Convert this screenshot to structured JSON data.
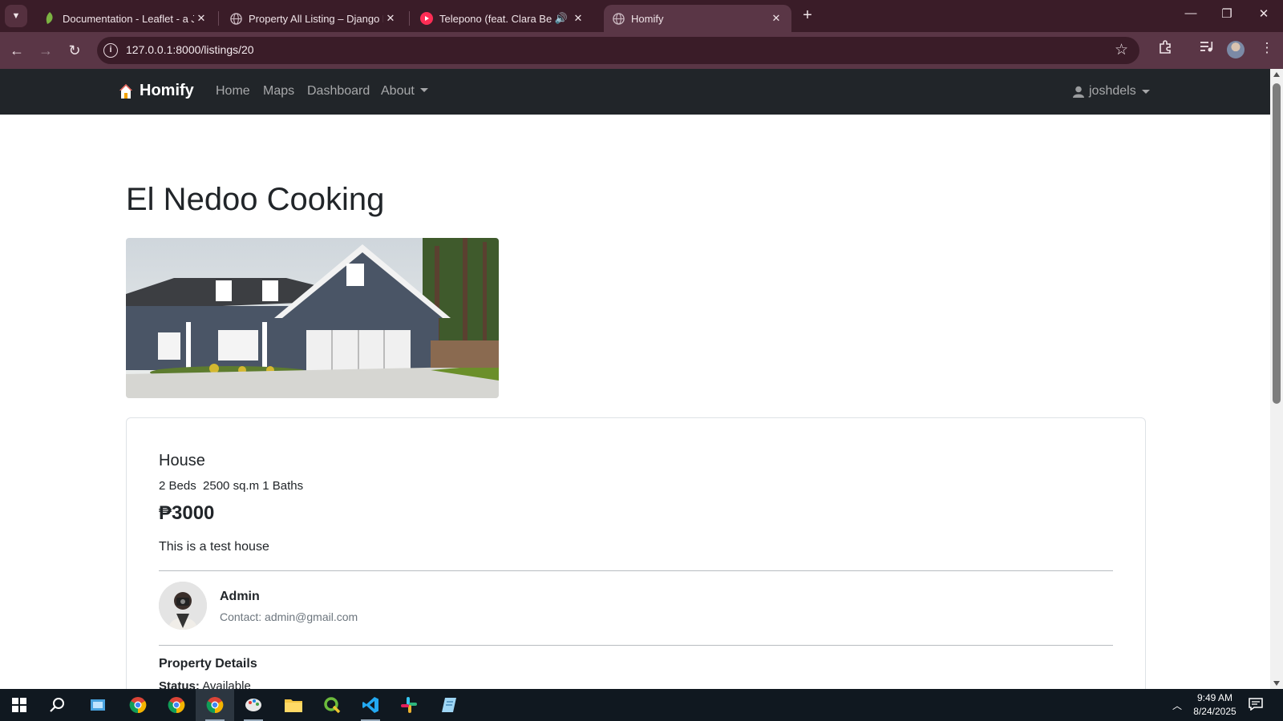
{
  "browser": {
    "tabs": [
      {
        "title": "Documentation - Leaflet - a Jav",
        "icon": "leaf-icon",
        "color": "#7cb342"
      },
      {
        "title": "Property All Listing – Django RE",
        "icon": "globe-icon",
        "color": "#c9b7bf"
      },
      {
        "title": "Telepono (feat. Clara Benin)",
        "icon": "youtube-icon",
        "color": "#ff2d55"
      },
      {
        "title": "Homify",
        "icon": "globe-icon",
        "color": "#c9b7bf"
      }
    ],
    "url": "127.0.0.1:8000/listings/20"
  },
  "navbar": {
    "brand": "Homify",
    "links": [
      "Home",
      "Maps",
      "Dashboard",
      "About"
    ],
    "user": "joshdels"
  },
  "listing": {
    "title": "El Nedoo Cooking",
    "type": "House",
    "specs": "2 Beds  2500 sq.m 1 Baths",
    "price": "₱3000",
    "description": "This is a test house",
    "agent": {
      "name": "Admin",
      "contact": "Contact: admin@gmail.com"
    },
    "details_heading": "Property Details",
    "status_label": "Status:",
    "status_value": "Available"
  },
  "taskbar": {
    "time": "9:49 AM",
    "date": "8/24/2025"
  },
  "colors": {
    "chrome_dark": "#3a1c28",
    "chrome_light": "#5a3646",
    "navbar_bg": "#212529"
  }
}
